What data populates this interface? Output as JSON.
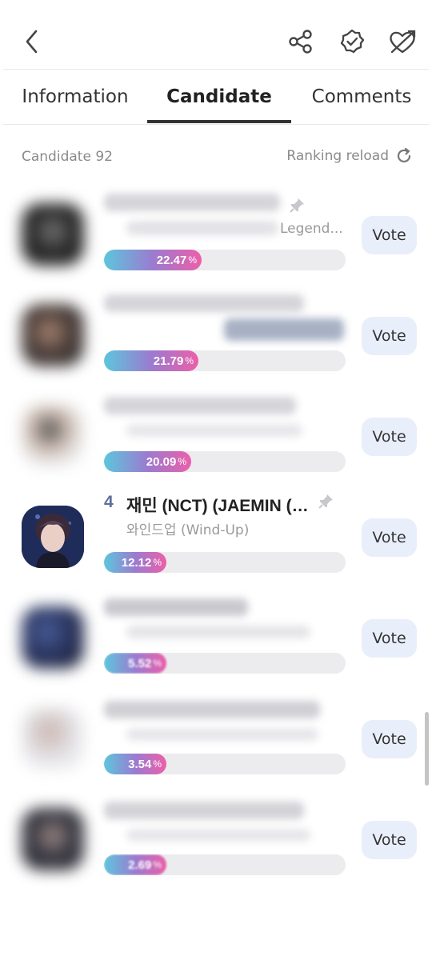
{
  "header": {
    "back_icon": "chevron-left-icon",
    "share_icon": "share-icon",
    "badge_icon": "verified-badge-icon",
    "heart_icon": "heart-arrow-icon"
  },
  "tabs": [
    {
      "label": "Information",
      "active": false
    },
    {
      "label": "Candidate",
      "active": true
    },
    {
      "label": "Comments",
      "active": false
    }
  ],
  "subheader": {
    "count_label": "Candidate 92",
    "reload_label": "Ranking reload"
  },
  "candidates": [
    {
      "rank": "",
      "name": "",
      "agency": "Legend...",
      "percent": "22.47",
      "fraction": 0.2247,
      "vote_label": "Vote"
    },
    {
      "rank": "",
      "name": "",
      "agency": "",
      "percent": "21.79",
      "fraction": 0.2179,
      "vote_label": "Vote"
    },
    {
      "rank": "",
      "name": "",
      "agency": "",
      "percent": "20.09",
      "fraction": 0.2009,
      "vote_label": "Vote"
    },
    {
      "rank": "4",
      "name": "재민 (NCT) (JAEMIN (N...",
      "agency": "와인드업 (Wind-Up)",
      "percent": "12.12",
      "fraction": 0.1212,
      "vote_label": "Vote"
    },
    {
      "rank": "",
      "name": "",
      "agency": "",
      "percent": "5.52",
      "fraction": 0.0552,
      "vote_label": "Vote"
    },
    {
      "rank": "",
      "name": "",
      "agency": "",
      "percent": "3.54",
      "fraction": 0.0354,
      "vote_label": "Vote"
    },
    {
      "rank": "",
      "name": "",
      "agency": "",
      "percent": "2.69",
      "fraction": 0.0269,
      "vote_label": "Vote"
    }
  ],
  "percent_suffix": "%",
  "colors": {
    "bar_start": "#5cc6dc",
    "bar_end": "#ec5fa9",
    "vote_bg": "#e9eefb",
    "rank_color": "#5c6f9a"
  }
}
